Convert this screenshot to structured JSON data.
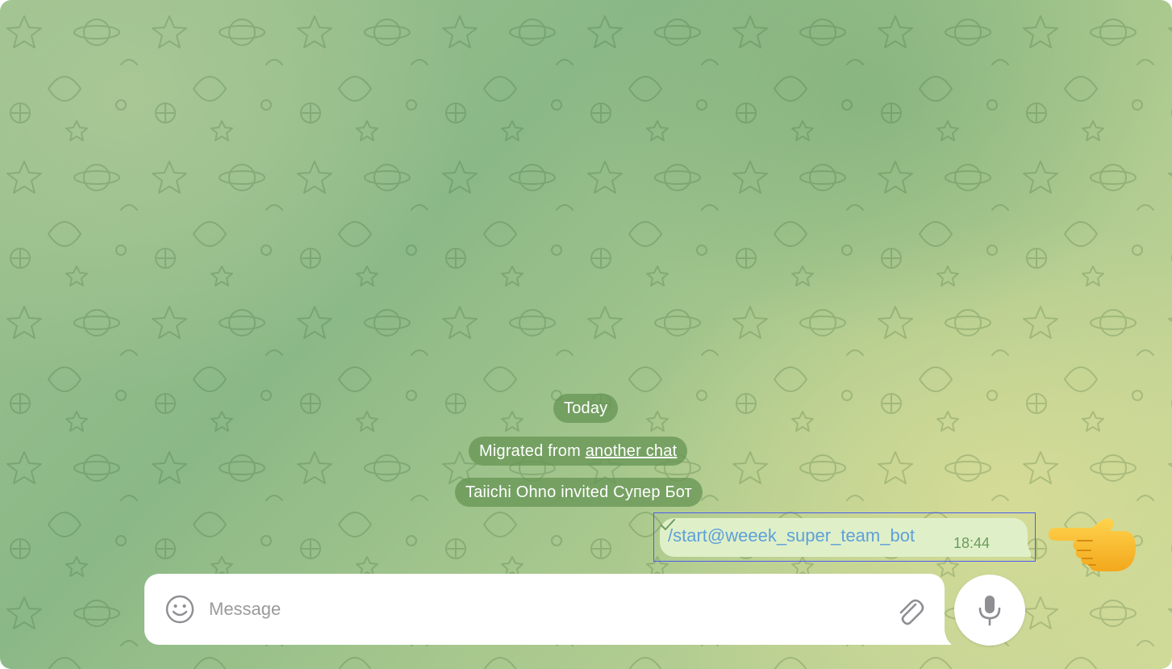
{
  "chat": {
    "date_label": "Today",
    "service_messages": {
      "migrated_prefix": "Migrated from ",
      "migrated_link": "another chat",
      "invited": "Taiichi Ohno invited Супер Бот"
    },
    "message": {
      "text": "/start@weeek_super_team_bot",
      "time": "18:44",
      "status": "sent"
    }
  },
  "composer": {
    "placeholder": "Message",
    "value": ""
  },
  "icons": {
    "emoji": "smile-icon",
    "attach": "paperclip-icon",
    "mic": "microphone-icon",
    "check": "check-icon",
    "pointer": "pointing-hand-emoji"
  },
  "colors": {
    "service_bg": "#6a9656",
    "bubble_bg": "#dff0c9",
    "bubble_text": "#5fa0d8",
    "meta": "#6c9a5e",
    "highlight": "#4a5cf0"
  }
}
